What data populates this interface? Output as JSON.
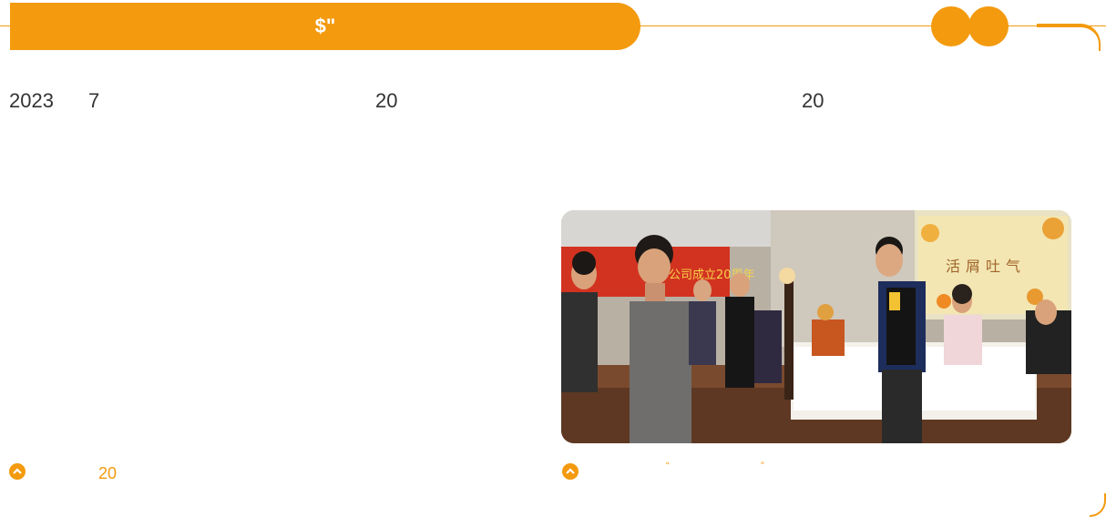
{
  "header": {
    "title": "$\""
  },
  "body_text": {
    "year": "2023",
    "month": "7",
    "num_a": "20",
    "num_b": "20"
  },
  "captions": {
    "left": "20",
    "right_open_quote": "“",
    "right_close_quote": "”"
  },
  "photo": {
    "banner_text": "活屑吐气",
    "banner_text_left": "公司成立20周年"
  },
  "colors": {
    "accent": "#f39a0e",
    "text": "#333333"
  }
}
